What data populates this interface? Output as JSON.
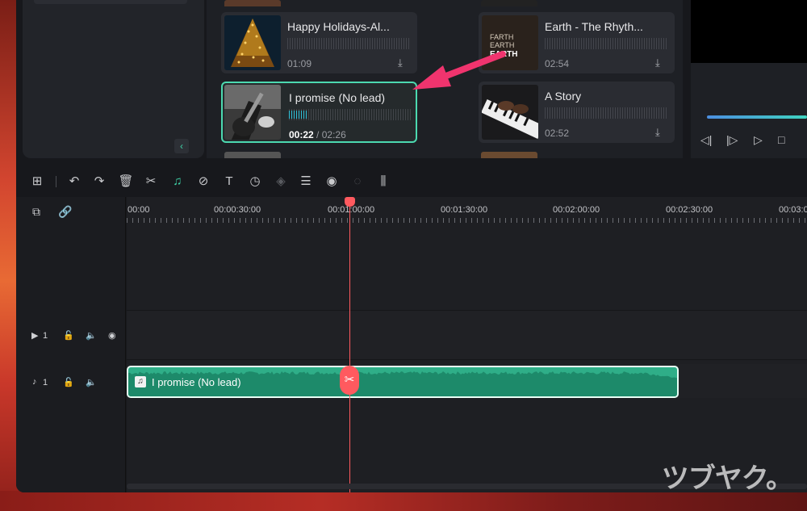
{
  "media": {
    "cards": [
      {
        "title": "Happy Holidays-Al...",
        "duration": "01:09",
        "selected": false
      },
      {
        "title": "Earth - The Rhyth...",
        "duration": "02:54",
        "selected": false,
        "thumb_text": "FARTH EARTH EARTH"
      },
      {
        "title": "I promise (No lead)",
        "current": "00:22",
        "separator": " / ",
        "total": "02:26",
        "selected": true
      },
      {
        "title": "A Story",
        "duration": "02:52",
        "selected": false
      }
    ]
  },
  "toolbar": {
    "icons": [
      "layout-icon",
      "undo-icon",
      "redo-icon",
      "delete-icon",
      "cut-icon",
      "audio-icon",
      "tag-icon",
      "text-icon",
      "speed-icon",
      "mask-icon",
      "adjust-icon",
      "audio-stretch-icon",
      "tts-icon",
      "beat-icon"
    ]
  },
  "timeline": {
    "ruler": [
      "00:00",
      "00:00:30:00",
      "00:01:00:00",
      "00:01:30:00",
      "00:02:00:00",
      "00:02:30:00",
      "00:03:0"
    ],
    "video_track": {
      "index": "1"
    },
    "audio_track": {
      "index": "1"
    },
    "clip": {
      "label": "I promise (No lead)"
    }
  },
  "watermark": "ツブヤク。",
  "colors": {
    "accent": "#3fd3a8",
    "playhead": "#ff5a5f",
    "clip": "#2fae88"
  }
}
